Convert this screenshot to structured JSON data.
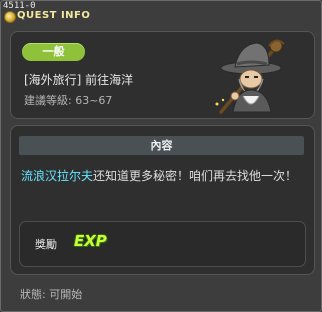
{
  "window": {
    "id_label": "4511-0",
    "title": "QUEST INFO"
  },
  "quest": {
    "category": "一般",
    "title": "[海外旅行] 前往海洋",
    "level_requirement": "建議等級: 63~67"
  },
  "content": {
    "header": "內容",
    "npc_name": "流浪汉拉尔夫",
    "text_rest": "还知道更多秘密！咱们再去找他一次！"
  },
  "reward": {
    "label": "獎勵",
    "exp_icon_text": "EXP"
  },
  "status": {
    "text": "狀態: 可開始"
  },
  "colors": {
    "badge": "#8fc23a",
    "npc_highlight": "#66e6ff",
    "exp": "#c6ff3a",
    "title_text": "#f2e9a0"
  },
  "icons": {
    "title_icon": "quest-coin-icon",
    "npc": "wandering-old-man-portrait",
    "reward": "exp-icon"
  }
}
